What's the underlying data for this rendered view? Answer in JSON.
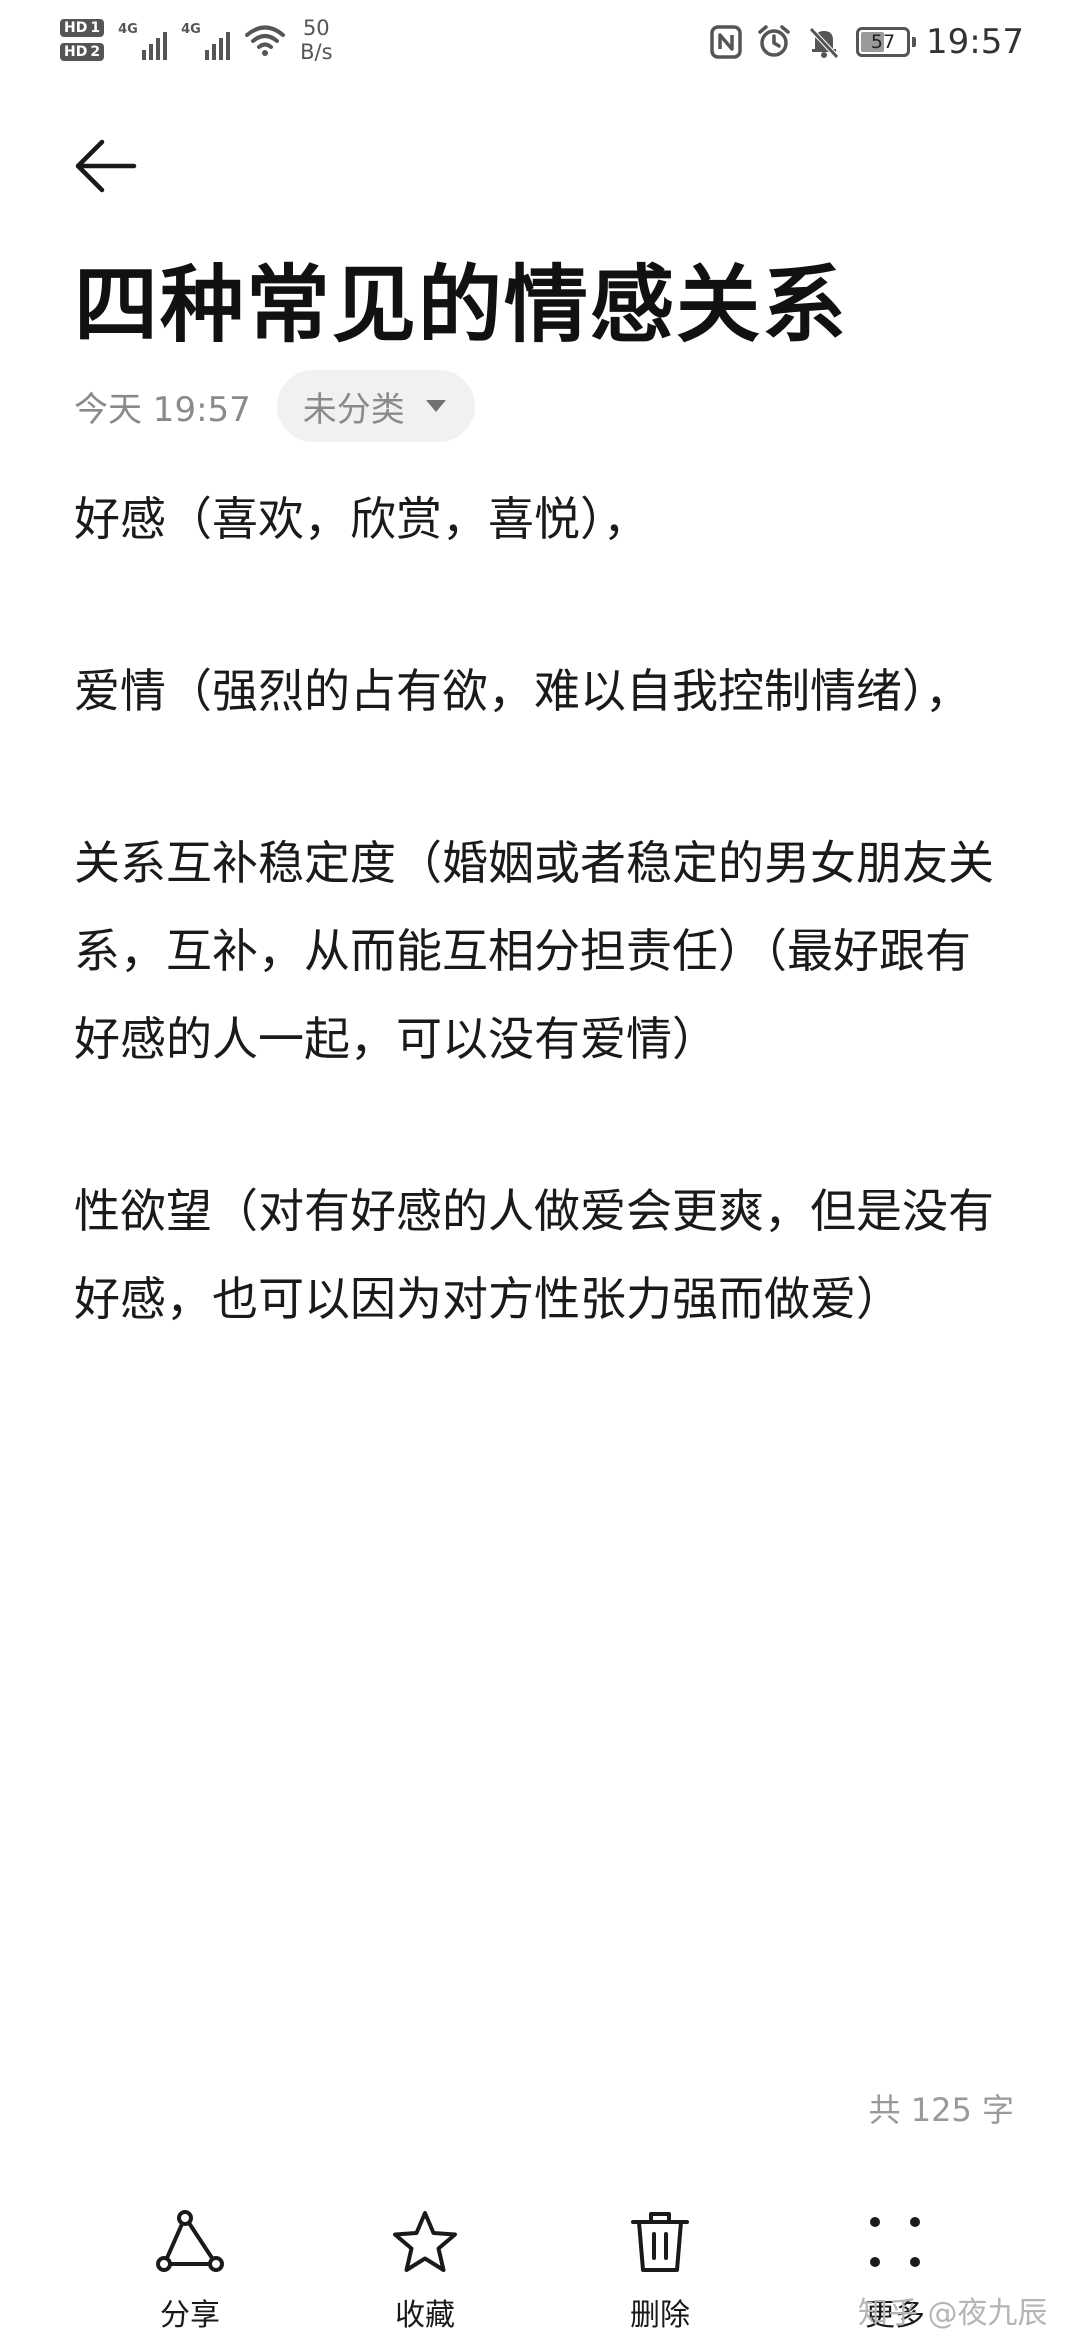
{
  "status_bar": {
    "hd1": "HD",
    "hd1_num": "1",
    "hd2": "HD",
    "hd2_num": "2",
    "net1": "4G",
    "net2": "4G",
    "speed_value": "50",
    "speed_unit": "B/s",
    "battery_level": "57",
    "battery_fraction": 0.57,
    "time": "19:57",
    "icons": [
      "nfc-icon",
      "alarm-icon",
      "mute-bell-icon",
      "battery-icon"
    ]
  },
  "header": {
    "back_icon": "back-arrow-icon",
    "title": "四种常见的情感关系",
    "date": "今天 19:57",
    "category": "未分类",
    "category_icon": "triangle-down-icon"
  },
  "body": {
    "paragraphs": [
      "好感（喜欢，欣赏，喜悦），",
      "爱情（强烈的占有欲，难以自我控制情绪），",
      "关系互补稳定度（婚姻或者稳定的男女朋友关系，互补，从而能互相分担责任）（最好跟有好感的人一起，可以没有爱情）",
      "性欲望（对有好感的人做爱会更爽，但是没有好感，也可以因为对方性张力强而做爱）"
    ]
  },
  "footer": {
    "word_count": "共 125 字"
  },
  "toolbar": {
    "share": {
      "label": "分享",
      "icon": "share-icon"
    },
    "favorite": {
      "label": "收藏",
      "icon": "star-icon"
    },
    "delete": {
      "label": "删除",
      "icon": "trash-icon"
    },
    "more": {
      "label": "更多",
      "icon": "more-dots-icon"
    }
  },
  "watermark": "知乎 @夜九辰",
  "colors": {
    "text": "#1a1a1a",
    "muted": "#8a8a8a",
    "chip_bg": "#f1f1f1",
    "background": "#ffffff"
  }
}
